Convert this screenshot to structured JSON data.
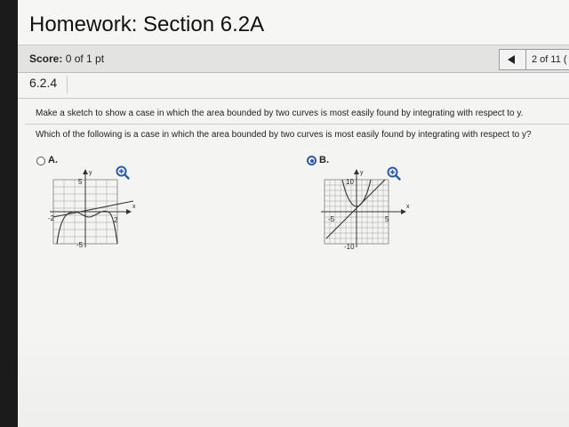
{
  "header": {
    "title": "Homework: Section 6.2A"
  },
  "score": {
    "label": "Score:",
    "value": "0 of 1 pt"
  },
  "navigation": {
    "position": "2 of 11 ("
  },
  "question": {
    "number": "6.2.4",
    "instruction": "Make a sketch to show a case in which the area bounded by two curves is most easily found by integrating with respect to y.",
    "prompt": "Which of the following is a case in which the area bounded by two curves is most easily found by integrating with respect to y?"
  },
  "options": [
    {
      "label": "A.",
      "selected": false,
      "graph": {
        "y_axis_label": "y",
        "x_axis_label": "x",
        "y_top_tick": "5",
        "y_bottom_tick": "-5",
        "x_left_tick": "-2",
        "x_right_tick": "2"
      }
    },
    {
      "label": "B.",
      "selected": true,
      "graph": {
        "y_axis_label": "y",
        "x_axis_label": "x",
        "y_top_tick": "10",
        "y_bottom_tick": "-10",
        "x_left_tick": "-5",
        "x_right_tick": "5"
      }
    }
  ],
  "colors": {
    "accent": "#2b5aa8",
    "curve": "#333333",
    "grid": "#b9b9b9"
  },
  "icons": {
    "zoom": "magnifier-plus-icon",
    "prev": "triangle-left-icon"
  }
}
